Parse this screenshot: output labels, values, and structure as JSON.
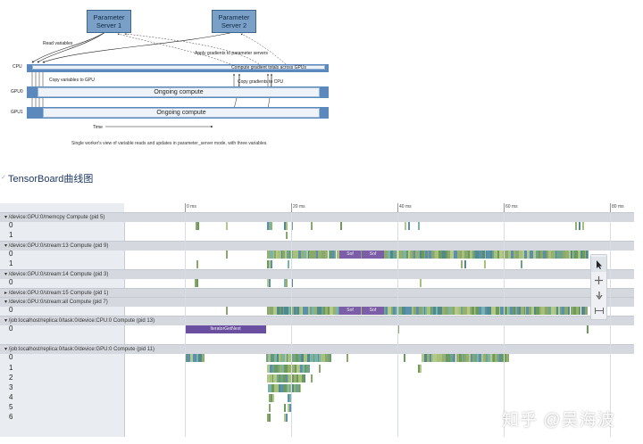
{
  "diagram": {
    "ps1": "Parameter\nServer 1",
    "ps2": "Parameter\nServer 2",
    "read_variables": "Read variables",
    "apply_gradients": "Apply gradients to parameter servers",
    "compute_gradient_totals": "Compute gradient totals across GPUs",
    "copy_variables_to_gpu": "Copy variables to GPU",
    "copy_gradients_to_cpu": "Copy gradients to CPU",
    "cpu_label": "CPU",
    "gpu0_label": "GPU0",
    "gpu1_label": "GPU1",
    "ongoing_compute": "Ongoing compute",
    "time_label": "Time",
    "caption": "Single worker's view of variable reads and updates in parameter_server mode, with three variables."
  },
  "section": {
    "chevron": "✓",
    "title": "TensorBoard曲线图"
  },
  "trace": {
    "ruler_ticks": [
      "0 ms",
      "20 ms",
      "40 ms",
      "60 ms",
      "80 ms"
    ],
    "groups": [
      {
        "label": "▾ /device:GPU:0/memcpy Compute (pid 5)"
      },
      {
        "label": "▾ /device:GPU:0/stream:13 Compute (pid 9)"
      },
      {
        "label": "▾ /device:GPU:0/stream:14 Compute (pid 3)"
      },
      {
        "label": "▸ /device:GPU:0/stream:15 Compute (pid 1)"
      },
      {
        "label": "▾ /device:GPU:0/stream:all Compute (pid 7)"
      },
      {
        "label": "▾ /job:localhost/replica:0/task:0/device:CPU:0 Compute (pid 13)"
      },
      {
        "label": "▾ /job:localhost/replica:0/task:0/device:GPU:0 Compute (pid 11)"
      }
    ],
    "tracks": [
      "0",
      "1",
      "0",
      "1",
      "0",
      "0",
      "0",
      "0",
      "1",
      "2",
      "3",
      "4",
      "5",
      "6"
    ],
    "slices": {
      "sof": "Sof",
      "tensor_get_next": "IteratorGetNext"
    },
    "tools": {
      "select": "select-tool",
      "pan": "pan-tool",
      "zoom": "zoom-tool",
      "timing": "timing-tool"
    }
  },
  "watermark": "知乎 @吴海波",
  "colors": {
    "accent": "#1f3a66",
    "bar": "#5b88bd",
    "ps": "#7aa0c8",
    "slice_purple": "#7b5ea7"
  }
}
